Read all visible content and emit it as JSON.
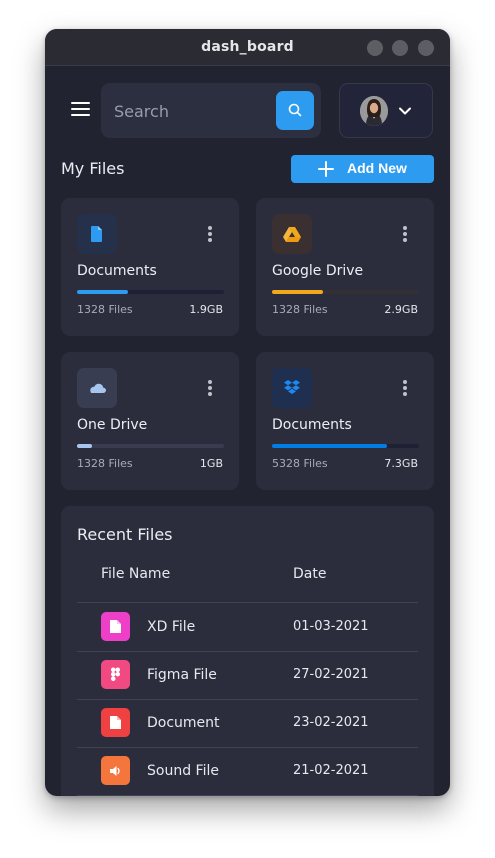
{
  "window": {
    "title": "dash_board"
  },
  "search": {
    "placeholder": "Search"
  },
  "my_files": {
    "title": "My Files",
    "add_label": "Add New",
    "cards": [
      {
        "name": "Documents",
        "count": "1328 Files",
        "size": "1.9GB",
        "usage": 0.35,
        "icon": "document-icon",
        "accent": "#2d9cf0"
      },
      {
        "name": "Google Drive",
        "count": "1328 Files",
        "size": "2.9GB",
        "usage": 0.35,
        "icon": "google-drive-icon",
        "accent": "#f2a81d"
      },
      {
        "name": "One Drive",
        "count": "1328 Files",
        "size": "1GB",
        "usage": 0.1,
        "icon": "cloud-icon",
        "accent": "#a6c6f0"
      },
      {
        "name": "Documents",
        "count": "5328 Files",
        "size": "7.3GB",
        "usage": 0.78,
        "icon": "dropbox-icon",
        "accent": "#007ee5"
      }
    ]
  },
  "recent_files": {
    "title": "Recent Files",
    "columns": [
      "File Name",
      "Date"
    ],
    "rows": [
      {
        "name": "XD File",
        "date": "01-03-2021",
        "icon": "xd-file-icon",
        "color": "#ee3fc8"
      },
      {
        "name": "Figma File",
        "date": "27-02-2021",
        "icon": "figma-icon",
        "color": "#f14a82"
      },
      {
        "name": "Document",
        "date": "23-02-2021",
        "icon": "document-icon",
        "color": "#ef4141"
      },
      {
        "name": "Sound File",
        "date": "21-02-2021",
        "icon": "sound-icon",
        "color": "#f5763d"
      }
    ]
  }
}
